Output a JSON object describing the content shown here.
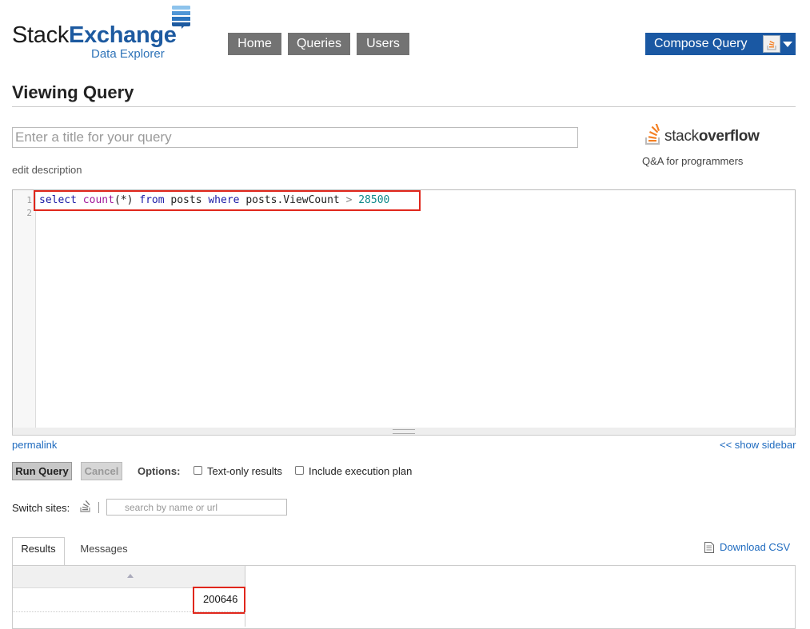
{
  "header": {
    "logo_word1": "Stack",
    "logo_word2": "Exchange",
    "logo_sub": "Data Explorer",
    "nav": [
      "Home",
      "Queries",
      "Users"
    ],
    "compose_label": "Compose Query"
  },
  "page": {
    "title": "Viewing Query",
    "title_placeholder": "Enter a title for your query",
    "edit_description": "edit description"
  },
  "site": {
    "name_light": "stack",
    "name_bold": "overflow",
    "tagline": "Q&A for programmers",
    "icon": "stackoverflow-icon"
  },
  "editor": {
    "line_numbers": [
      "1",
      "2"
    ],
    "code_tokens": {
      "select": "select",
      "count": "count",
      "paren": "(*)",
      "from": "from",
      "table": "posts",
      "where": "where",
      "column": "posts.ViewCount",
      "op": ">",
      "value": "28500"
    }
  },
  "links": {
    "permalink": "permalink",
    "show_sidebar": "<< show sidebar"
  },
  "controls": {
    "run_label": "Run Query",
    "cancel_label": "Cancel",
    "options_label": "Options:",
    "text_only_label": "Text-only results",
    "exec_plan_label": "Include execution plan",
    "text_only_checked": false,
    "exec_plan_checked": false
  },
  "switch": {
    "label": "Switch sites:",
    "placeholder": "search by name or url"
  },
  "tabs": {
    "results": "Results",
    "messages": "Messages",
    "download_csv": "Download CSV"
  },
  "results": {
    "rows": [
      [
        "200646"
      ]
    ]
  },
  "colors": {
    "brand_blue": "#1a58a3",
    "nav_gray": "#737373",
    "highlight_red": "#e0271c",
    "so_orange": "#f48024"
  }
}
